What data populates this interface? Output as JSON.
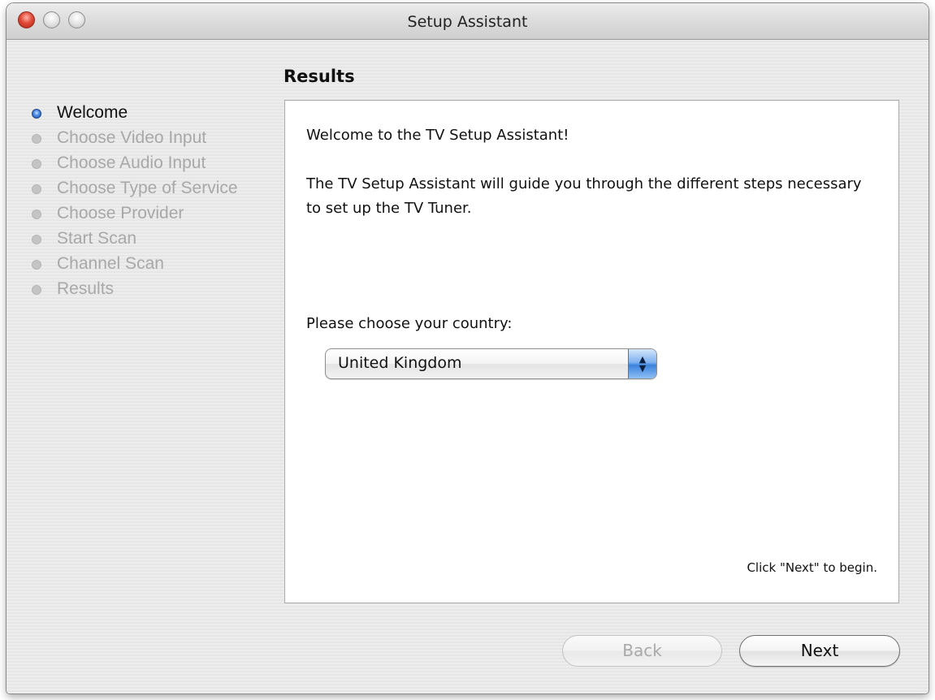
{
  "window": {
    "title": "Setup Assistant"
  },
  "sidebar": {
    "steps": [
      {
        "label": "Welcome",
        "active": true
      },
      {
        "label": "Choose Video Input",
        "active": false
      },
      {
        "label": "Choose Audio Input",
        "active": false
      },
      {
        "label": "Choose Type of Service",
        "active": false
      },
      {
        "label": "Choose Provider",
        "active": false
      },
      {
        "label": "Start Scan",
        "active": false
      },
      {
        "label": "Channel Scan",
        "active": false
      },
      {
        "label": "Results",
        "active": false
      }
    ]
  },
  "main": {
    "section_title": "Results",
    "welcome_heading": "Welcome to the TV Setup Assistant!",
    "welcome_body": "The TV Setup Assistant will guide you through the different steps necessary to set up the TV Tuner.",
    "country_label": "Please choose your country:",
    "country_select": {
      "value": "United Kingdom"
    },
    "hint": "Click \"Next\" to begin."
  },
  "buttons": {
    "back_label": "Back",
    "back_enabled": false,
    "next_label": "Next"
  },
  "colors": {
    "active_step_bullet": "#3a78d6",
    "inactive_step_text": "#a8a8a8",
    "close_button": "#e14a38"
  }
}
